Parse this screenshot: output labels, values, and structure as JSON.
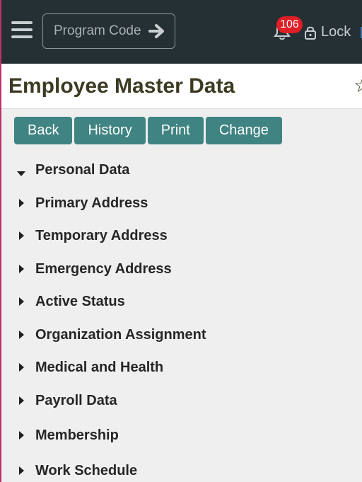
{
  "topbar": {
    "program_code_label": "Program Code",
    "notification_count": "106",
    "lock_label": "Lock"
  },
  "page": {
    "title": "Employee Master Data"
  },
  "actions": [
    "Back",
    "History",
    "Print",
    "Change"
  ],
  "sections": [
    {
      "label": "Personal Data",
      "expanded": true
    },
    {
      "label": "Primary Address",
      "expanded": false
    },
    {
      "label": "Temporary Address",
      "expanded": false
    },
    {
      "label": "Emergency Address",
      "expanded": false
    },
    {
      "label": "Active Status",
      "expanded": false
    },
    {
      "label": "Organization Assignment",
      "expanded": false
    },
    {
      "label": "Medical and Health",
      "expanded": false
    },
    {
      "label": "Payroll Data",
      "expanded": false
    },
    {
      "label": "Membership",
      "expanded": false
    },
    {
      "label": "Work Schedule",
      "expanded": false
    }
  ]
}
